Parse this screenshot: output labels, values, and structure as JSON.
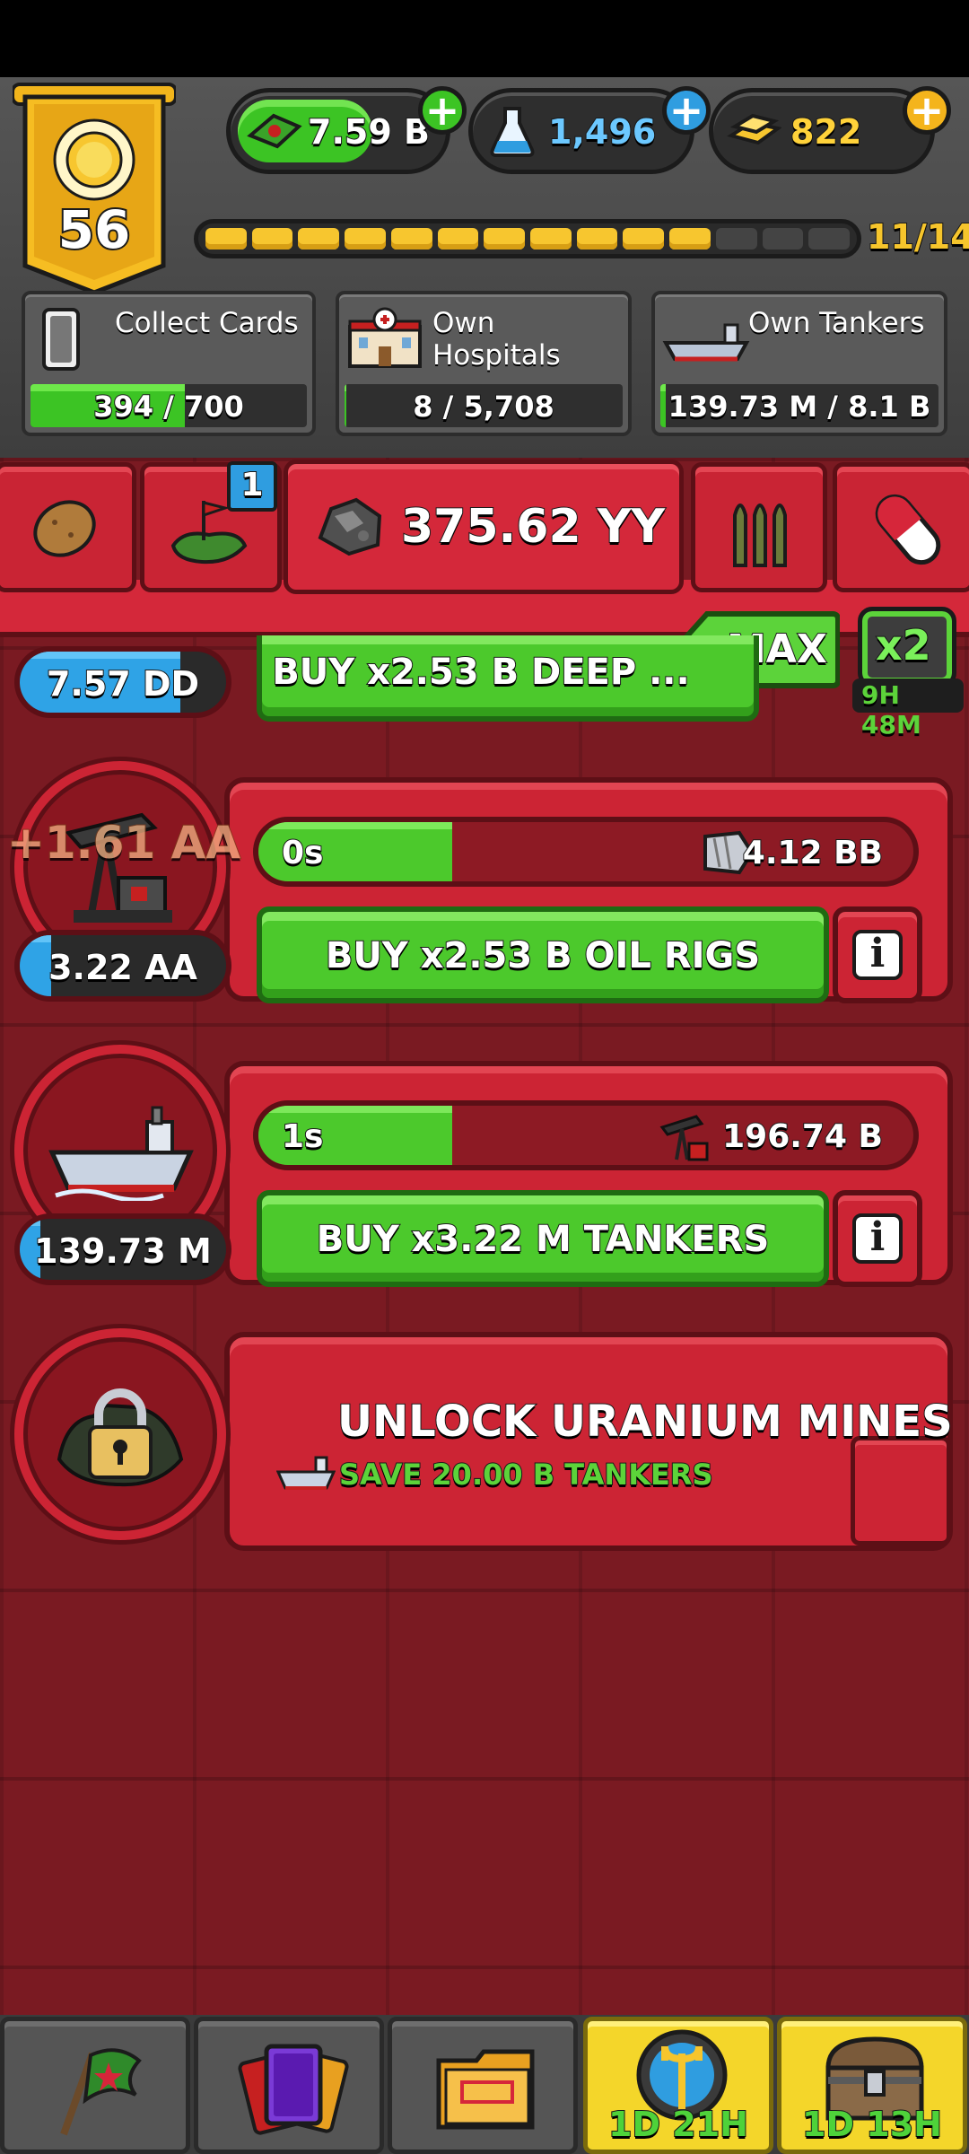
{
  "header": {
    "level": "56",
    "resources": [
      {
        "name": "cash",
        "icon": "cash-icon",
        "value": "7.59 B",
        "accent": "#3cc424"
      },
      {
        "name": "research",
        "icon": "flask-icon",
        "value": "1,496",
        "accent": "#2f9de0"
      },
      {
        "name": "gold",
        "icon": "gold-bars-icon",
        "value": "822",
        "accent": "#f4b41c"
      }
    ],
    "xp": {
      "current": 11,
      "total": 14,
      "label": "11/14"
    }
  },
  "goals": [
    {
      "label": "Collect Cards",
      "progress": "394 / 700",
      "fraction": 0.563,
      "icon": "card-icon"
    },
    {
      "label": "Own Hospitals",
      "progress": "8 / 5,708",
      "fraction": 0.001,
      "icon": "hospital-icon"
    },
    {
      "label": "Own Tankers",
      "progress": "139.73 M / 8.1 B",
      "fraction": 0.017,
      "icon": "tanker-icon"
    }
  ],
  "tabs": {
    "items": [
      {
        "icon": "potato-icon"
      },
      {
        "icon": "land-flag-icon",
        "badge": "1"
      },
      {
        "icon": "ore-icon",
        "active": true,
        "value": "375.62 YY"
      },
      {
        "icon": "ammo-icon"
      },
      {
        "icon": "pill-icon"
      }
    ],
    "max_label": "MAX",
    "boost_label": "x2",
    "boost_timer": "9H 48M"
  },
  "producers": [
    {
      "name": "deep",
      "owned": "7.57 DD",
      "buy_label": "BUY x2.53 B DEEP ...",
      "owned_fraction": 0.78
    },
    {
      "name": "oil-rigs",
      "owned": "3.22 AA",
      "floating": "+1.61 AA",
      "timer": "0s",
      "amount": "4.12 BB",
      "buy_label": "BUY x2.53 B OIL RIGS",
      "owned_fraction": 0.15,
      "cycle_fraction": 0.29
    },
    {
      "name": "tankers",
      "owned": "139.73 M",
      "timer": "1s",
      "amount": "196.74 B",
      "buy_label": "BUY x3.22 M TANKERS",
      "owned_fraction": 0.1,
      "cycle_fraction": 0.29
    }
  ],
  "locked": {
    "title": "UNLOCK URANIUM MINES",
    "requirement": "SAVE 20.00 B TANKERS"
  },
  "nav": [
    {
      "icon": "flag-icon"
    },
    {
      "icon": "cards-icon"
    },
    {
      "icon": "folder-icon"
    },
    {
      "icon": "event-trident-icon",
      "countdown": "1D 21H"
    },
    {
      "icon": "treasure-chest-icon",
      "countdown": "1D 13H"
    }
  ]
}
